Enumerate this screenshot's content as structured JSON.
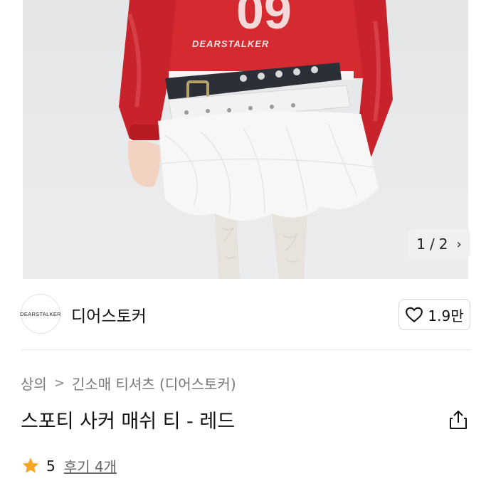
{
  "product_image": {
    "alt": "model wearing red jersey and white tulle skirt",
    "print_text": "DEARSTALKER",
    "jersey_number": "09",
    "colors": {
      "jersey": "#d42a30",
      "background": "#e6e7e9",
      "belt_dark": "#2b2f38",
      "skirt": "#f6f6f6"
    }
  },
  "pagination": {
    "current": "1",
    "separator": "/",
    "total": "2",
    "next_icon": "chevron-right-icon"
  },
  "seller": {
    "avatar_text": "DEARSTALKER",
    "name": "디어스토커"
  },
  "like": {
    "icon": "heart-icon",
    "count": "1.9만"
  },
  "breadcrumb": {
    "items": [
      "상의",
      "긴소매 티셔츠 (디어스토커)"
    ],
    "separator": ">"
  },
  "product": {
    "title": "스포티 사커 매쉬 티 - 레드",
    "share_icon": "share-icon"
  },
  "rating": {
    "score": "5",
    "review_label": "후기 4개",
    "star_color": "#f5a623"
  }
}
